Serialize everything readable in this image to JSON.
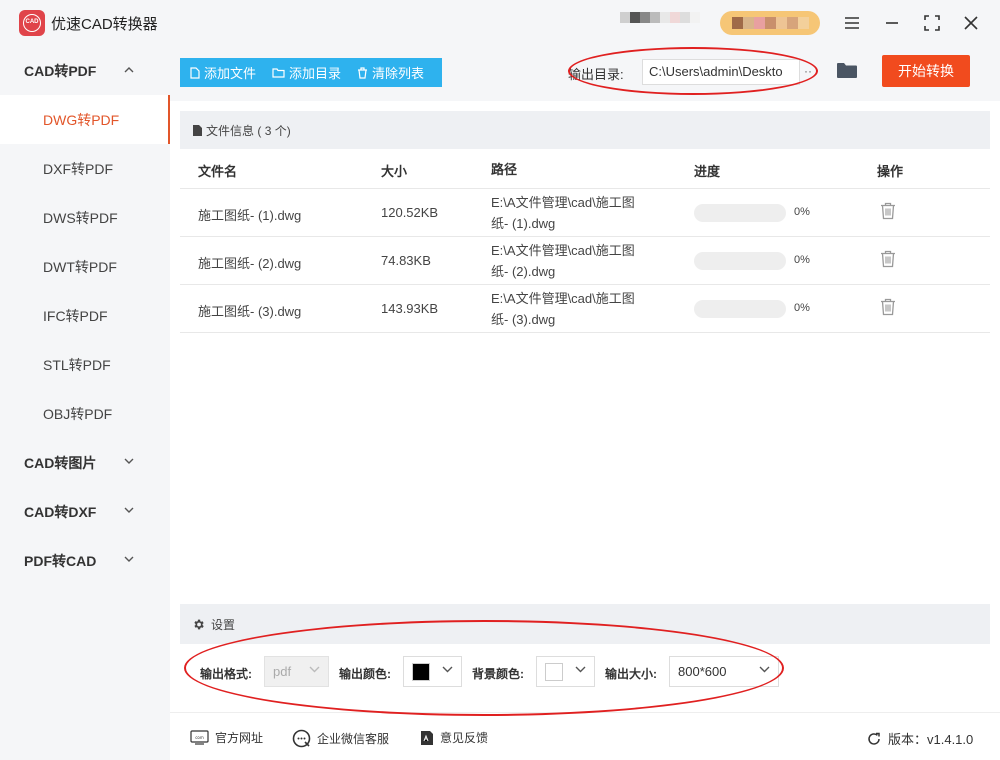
{
  "app": {
    "title": "优速CAD转换器",
    "logo_text": "CAD"
  },
  "window_controls": [
    "menu-icon",
    "minimize-icon",
    "maximize-icon",
    "close-icon"
  ],
  "sidebar": {
    "groups": [
      {
        "label": "CAD转PDF",
        "expanded": true
      },
      {
        "label": "CAD转图片",
        "expanded": false
      },
      {
        "label": "CAD转DXF",
        "expanded": false
      },
      {
        "label": "PDF转CAD",
        "expanded": false
      }
    ],
    "items": [
      "DWG转PDF",
      "DXF转PDF",
      "DWS转PDF",
      "DWT转PDF",
      "IFC转PDF",
      "STL转PDF",
      "OBJ转PDF"
    ],
    "active_item": "DWG转PDF"
  },
  "toolbar": {
    "add_file": "添加文件",
    "add_dir": "添加目录",
    "clear_list": "清除列表",
    "output_label": "输出目录:",
    "output_path": "C:\\Users\\admin\\Deskto",
    "output_more": "··",
    "start_button": "开始转换"
  },
  "file_panel": {
    "title": "文件信息",
    "count_text": "( 3 个)",
    "columns": [
      "文件名",
      "大小",
      "路径",
      "进度",
      "操作"
    ],
    "rows": [
      {
        "name": "施工图纸- (1).dwg",
        "size": "120.52KB",
        "path1": "E:\\A文件管理\\cad\\施工图",
        "path2": "纸- (1).dwg",
        "progress": 0,
        "progress_text": "0%"
      },
      {
        "name": "施工图纸- (2).dwg",
        "size": "74.83KB",
        "path1": "E:\\A文件管理\\cad\\施工图",
        "path2": "纸- (2).dwg",
        "progress": 0,
        "progress_text": "0%"
      },
      {
        "name": "施工图纸- (3).dwg",
        "size": "143.93KB",
        "path1": "E:\\A文件管理\\cad\\施工图",
        "path2": "纸- (3).dwg",
        "progress": 0,
        "progress_text": "0%"
      }
    ]
  },
  "settings": {
    "title": "设置",
    "format_label": "输出格式:",
    "format_value": "pdf",
    "color_label": "输出颜色:",
    "color_value": "#000000",
    "bg_label": "背景颜色:",
    "bg_value": "#ffffff",
    "size_label": "输出大小:",
    "size_value": "800*600"
  },
  "footer": {
    "website": "官方网址",
    "wechat": "企业微信客服",
    "feedback": "意见反馈",
    "version": "版本：v1.4.1.0"
  },
  "colors": {
    "accent": "#e2562a",
    "start_button": "#f14b1e",
    "toolbar_blue": "#2eb2ee",
    "annotation_red": "#e02020"
  }
}
